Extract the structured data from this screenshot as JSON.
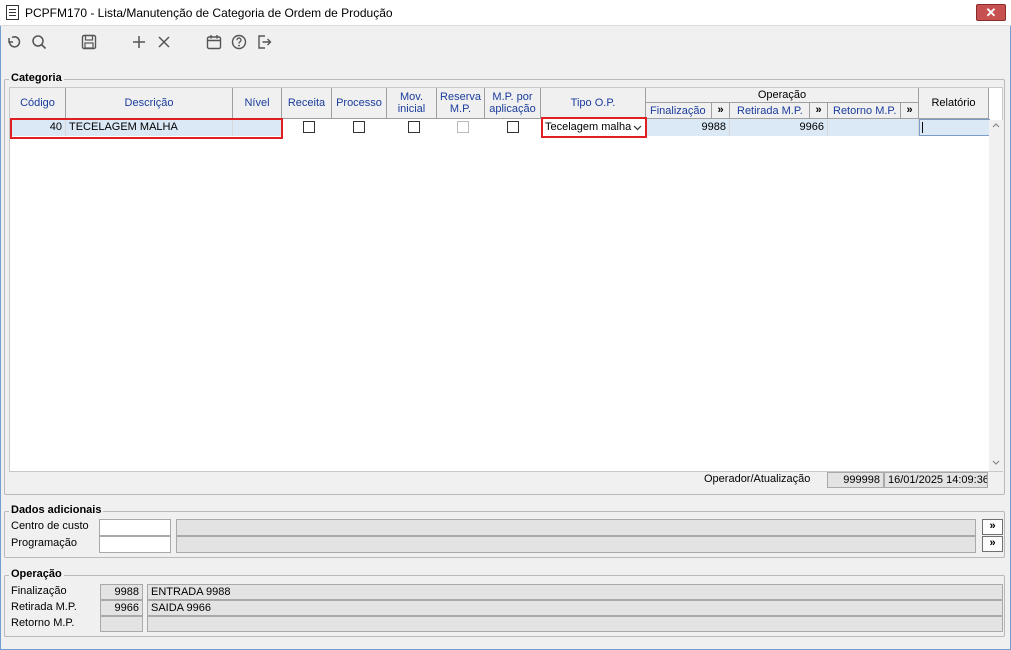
{
  "window": {
    "title": "PCPFM170 - Lista/Manutenção de Categoria de Ordem de Produção",
    "close_glyph": "✕"
  },
  "toolbar": {
    "icons": [
      "undo-icon",
      "search-icon",
      "save-icon",
      "add-icon",
      "delete-icon",
      "calendar-icon",
      "help-icon",
      "exit-icon"
    ]
  },
  "categoria": {
    "title": "Categoria",
    "columns": {
      "codigo": "Código",
      "descricao": "Descrição",
      "nivel": "Nível",
      "receita": "Receita",
      "processo": "Processo",
      "mov_inicial_1": "Mov.",
      "mov_inicial_2": "inicial",
      "reserva_1": "Reserva",
      "reserva_2": "M.P.",
      "mp_aplic_1": "M.P. por",
      "mp_aplic_2": "aplicação",
      "tipo_op": "Tipo O.P.",
      "operacao": "Operação",
      "finalizacao": "Finalização",
      "retirada": "Retirada M.P.",
      "retorno": "Retorno M.P.",
      "relatorio": "Relatório",
      "more_glyph": "»"
    },
    "rows": [
      {
        "codigo": "40",
        "descricao": "TECELAGEM MALHA",
        "nivel": "",
        "receita": false,
        "processo": false,
        "mov_inicial": false,
        "reserva_mp": false,
        "mp_aplicacao": false,
        "tipo_op": "Tecelagem malha",
        "finalizacao": "9988",
        "retirada": "9966",
        "retorno": "",
        "relatorio": ""
      }
    ],
    "operador_label": "Operador/Atualização",
    "operador_id": "999998",
    "operador_datetime": "16/01/2025 14:09:36"
  },
  "dados_adicionais": {
    "title": "Dados adicionais",
    "centro_custo_label": "Centro de custo",
    "centro_custo_value": "",
    "programacao_label": "Programação",
    "programacao_value": "",
    "more_glyph": "»"
  },
  "operacao": {
    "title": "Operação",
    "finalizacao_label": "Finalização",
    "finalizacao_code": "9988",
    "finalizacao_desc": "ENTRADA 9988",
    "retirada_label": "Retirada M.P.",
    "retirada_code": "9966",
    "retirada_desc": "SAIDA 9966",
    "retorno_label": "Retorno M.P.",
    "retorno_code": "",
    "retorno_desc": ""
  },
  "colors": {
    "selection": "#dbe9f7",
    "highlight": "#e02020",
    "header_text": "#1a3c9c"
  }
}
